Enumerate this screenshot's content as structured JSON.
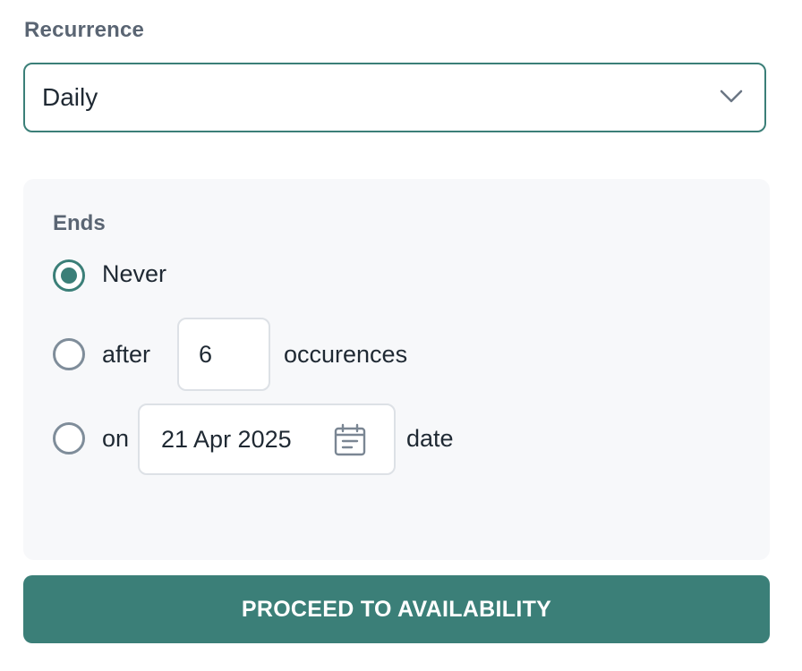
{
  "recurrence": {
    "label": "Recurrence",
    "selected": "Daily",
    "chevron_icon": "chevron-down-icon"
  },
  "ends": {
    "label": "Ends",
    "selected_option": "never",
    "options": {
      "never": {
        "label": "Never",
        "checked": true
      },
      "after": {
        "prefix": "after",
        "value": "6",
        "suffix": "occurences",
        "checked": false
      },
      "on": {
        "prefix": "on",
        "date": "21 Apr 2025",
        "suffix": "date",
        "checked": false,
        "calendar_icon": "calendar-icon"
      }
    }
  },
  "actions": {
    "proceed_label": "PROCEED TO AVAILABILITY"
  },
  "colors": {
    "accent": "#3b7f78",
    "panel_bg": "#f7f8fa",
    "label_gray": "#5a6573",
    "radio_unchecked": "#7f8d9a"
  }
}
